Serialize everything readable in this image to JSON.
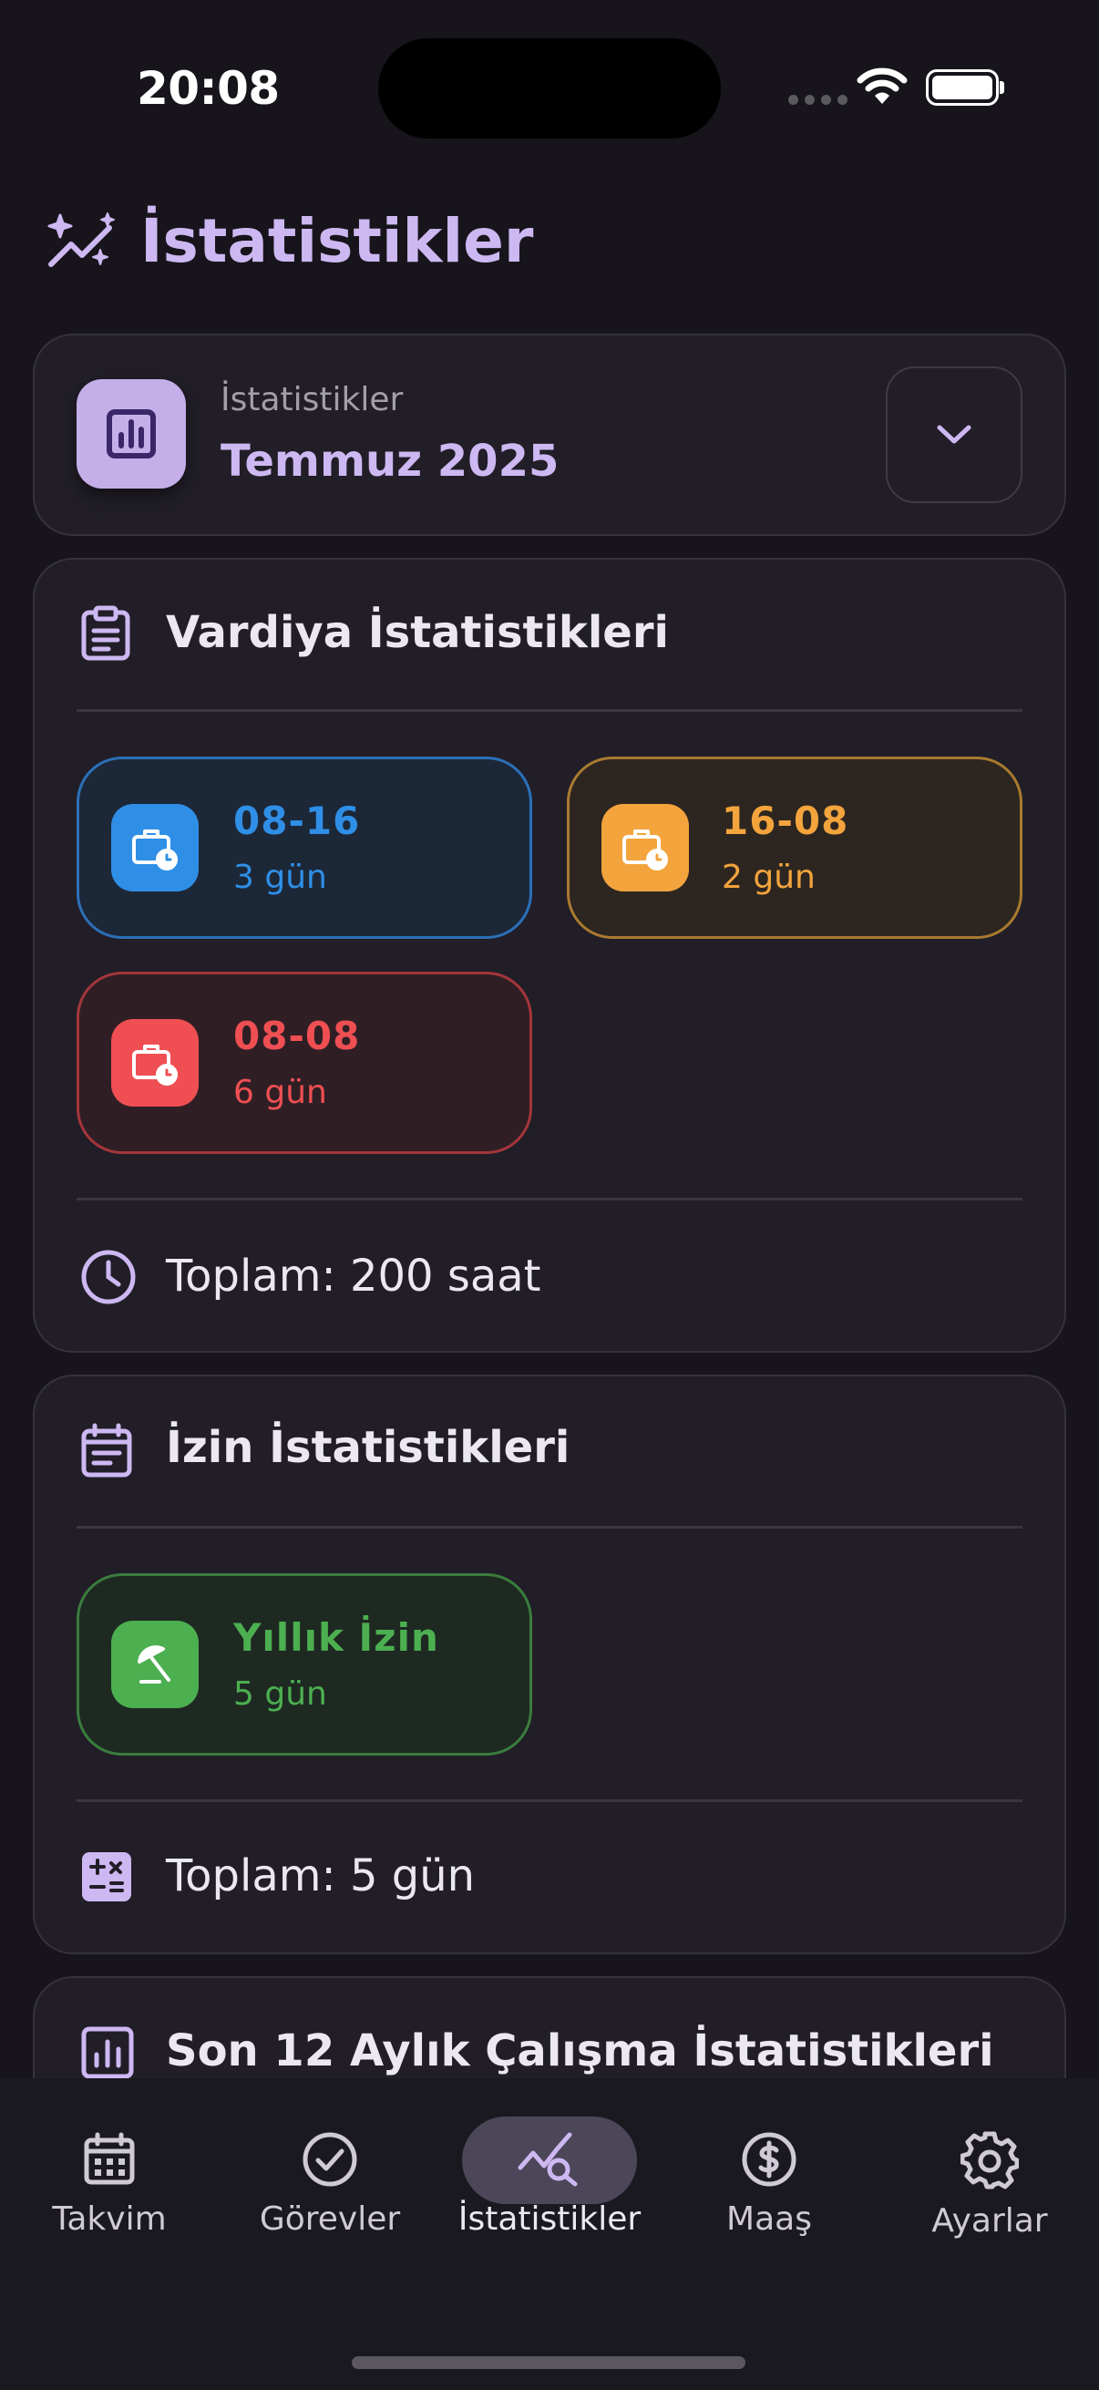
{
  "status_bar": {
    "time": "20:08"
  },
  "header": {
    "title": "İstatistikler",
    "icon": "sparkles-chart-icon"
  },
  "month_selector": {
    "label": "İstatistikler",
    "value": "Temmuz 2025",
    "icon": "bar-chart-icon"
  },
  "shift_stats": {
    "title": "Vardiya İstatistikleri",
    "items": [
      {
        "name": "08-16",
        "value": "3 gün",
        "color": "#2f8fe6"
      },
      {
        "name": "16-08",
        "value": "2 gün",
        "color": "#f3a43c"
      },
      {
        "name": "08-08",
        "value": "6 gün",
        "color": "#ef4f53"
      }
    ],
    "total": "Toplam: 200 saat"
  },
  "leave_stats": {
    "title": "İzin İstatistikleri",
    "items": [
      {
        "name": "Yıllık İzin",
        "value": "5 gün",
        "color": "#4caf50"
      }
    ],
    "total": "Toplam: 5 gün"
  },
  "yearly_stats": {
    "title": "Son 12 Aylık Çalışma İstatistikleri"
  },
  "nav": {
    "items": [
      {
        "label": "Takvim",
        "icon": "calendar-icon"
      },
      {
        "label": "Görevler",
        "icon": "check-circle-icon"
      },
      {
        "label": "İstatistikler",
        "icon": "stats-search-icon",
        "active": true
      },
      {
        "label": "Maaş",
        "icon": "dollar-circle-icon"
      },
      {
        "label": "Ayarlar",
        "icon": "gear-icon"
      }
    ]
  }
}
